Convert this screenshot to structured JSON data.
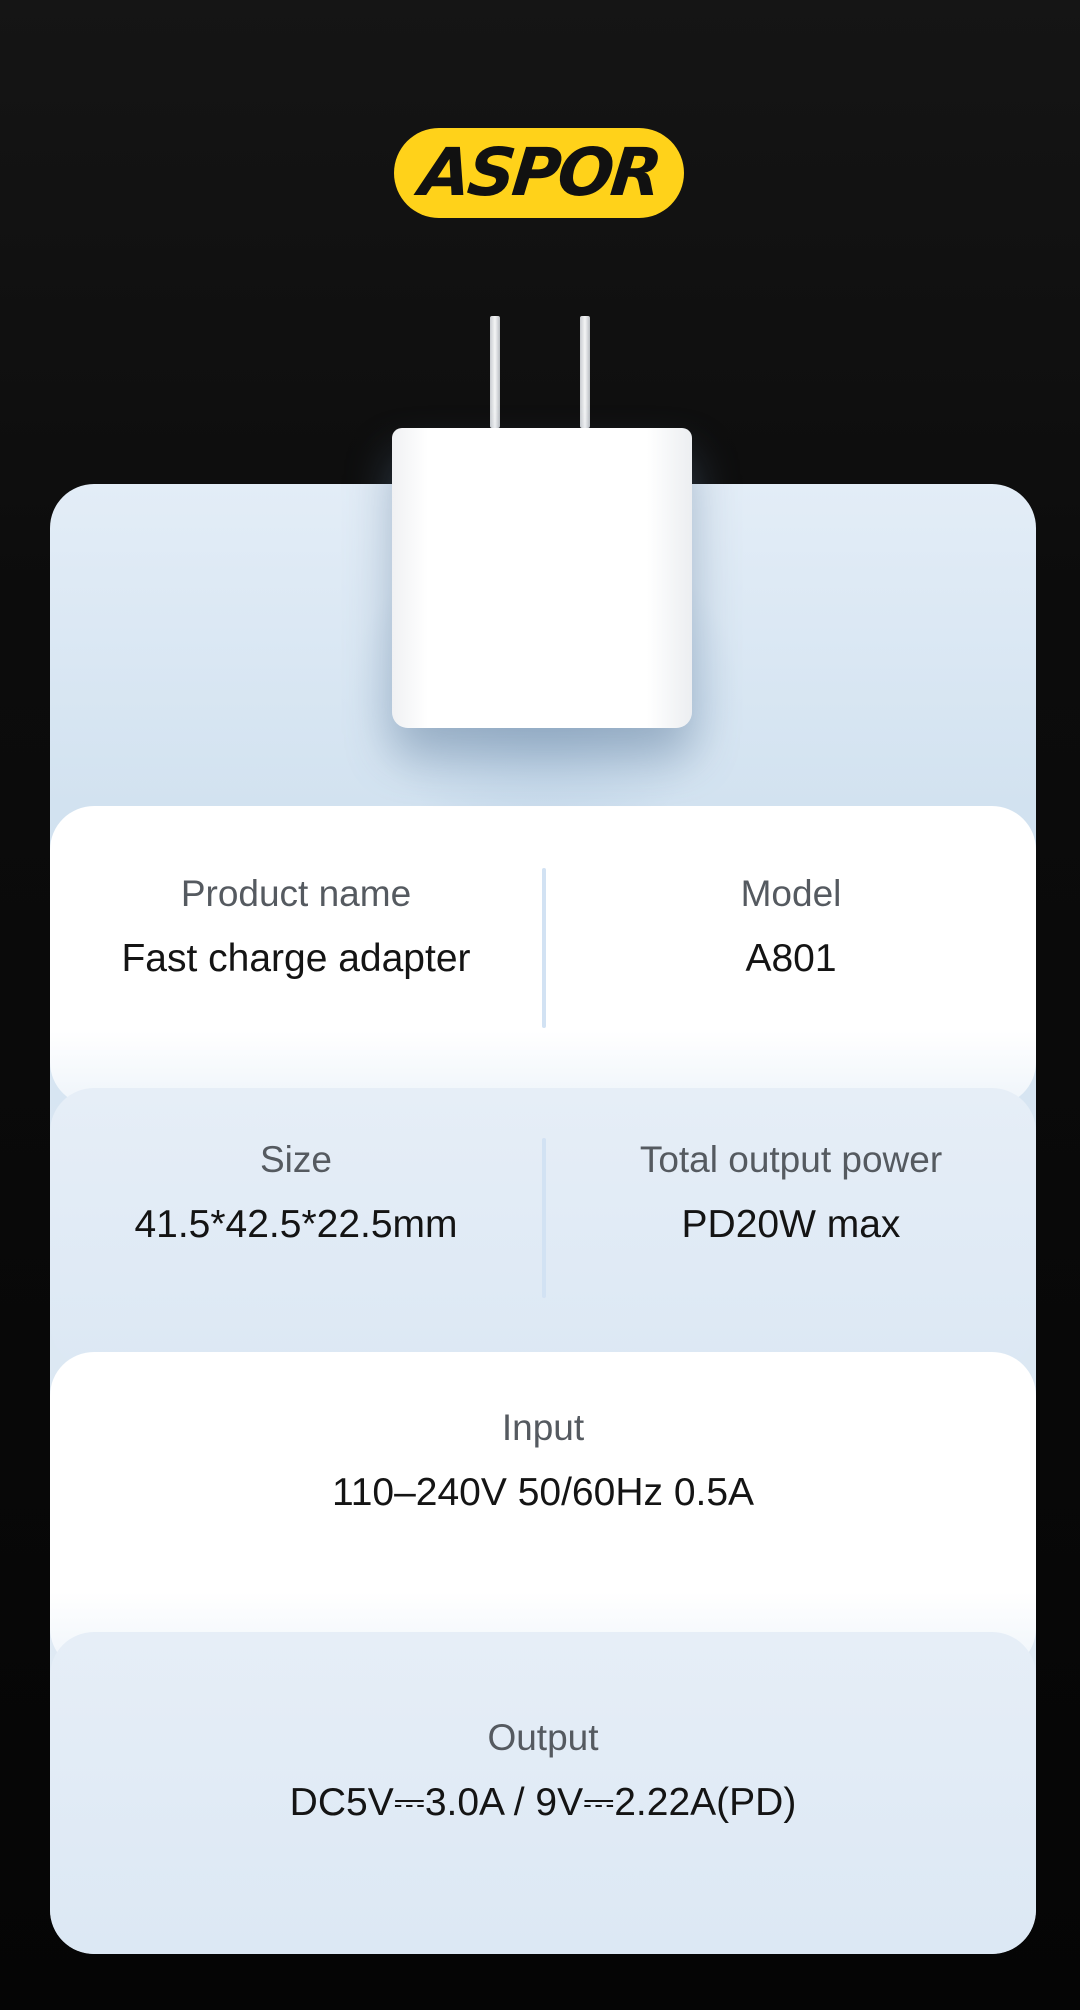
{
  "brand": {
    "logo_text": "ASPOR",
    "logo_color": "#ffd21a"
  },
  "specs": {
    "product_name": {
      "label": "Product name",
      "value": "Fast charge adapter"
    },
    "model": {
      "label": "Model",
      "value": "A801"
    },
    "size": {
      "label": "Size",
      "value": "41.5*42.5*22.5mm"
    },
    "total_output": {
      "label": "Total output power",
      "value": "PD20W max"
    },
    "input": {
      "label": "Input",
      "value": "110–240V 50/60Hz 0.5A"
    },
    "output": {
      "label": "Output",
      "value": "DC5V⎓3.0A / 9V⎓2.22A(PD)"
    }
  }
}
